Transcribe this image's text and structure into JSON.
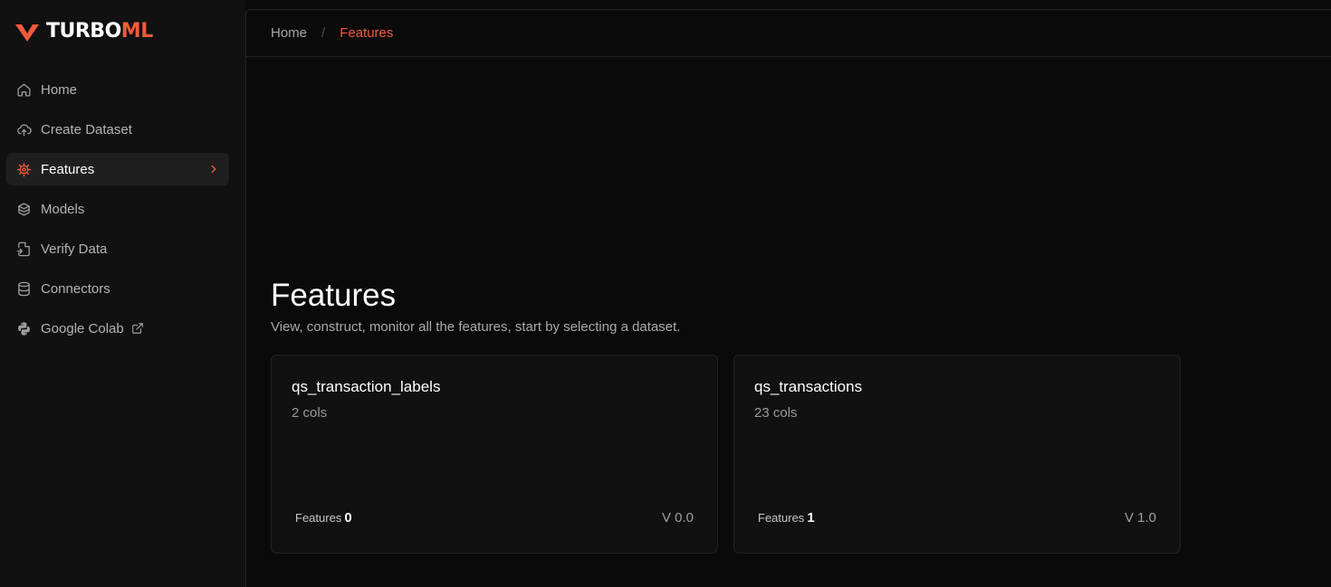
{
  "brand": {
    "name_main": "TURBO",
    "name_accent": "ML",
    "accent_color": "#f25a3c"
  },
  "sidebar": {
    "items": [
      {
        "label": "Home",
        "icon": "home-icon"
      },
      {
        "label": "Create Dataset",
        "icon": "cloud-upload-icon"
      },
      {
        "label": "Features",
        "icon": "cog-icon",
        "active": true
      },
      {
        "label": "Models",
        "icon": "boxes-icon"
      },
      {
        "label": "Verify Data",
        "icon": "file-plus-icon"
      },
      {
        "label": "Connectors",
        "icon": "database-icon"
      },
      {
        "label": "Google Colab",
        "icon": "python-icon",
        "external": true
      }
    ]
  },
  "breadcrumb": {
    "home": "Home",
    "separator": "/",
    "current": "Features"
  },
  "page": {
    "title": "Features",
    "subtitle": "View, construct, monitor all the features, start by selecting a dataset."
  },
  "datasets": [
    {
      "name": "qs_transaction_labels",
      "cols": "2 cols",
      "features_label": "Features",
      "features_count": "0",
      "version": "V 0.0"
    },
    {
      "name": "qs_transactions",
      "cols": "23 cols",
      "features_label": "Features",
      "features_count": "1",
      "version": "V 1.0"
    }
  ]
}
